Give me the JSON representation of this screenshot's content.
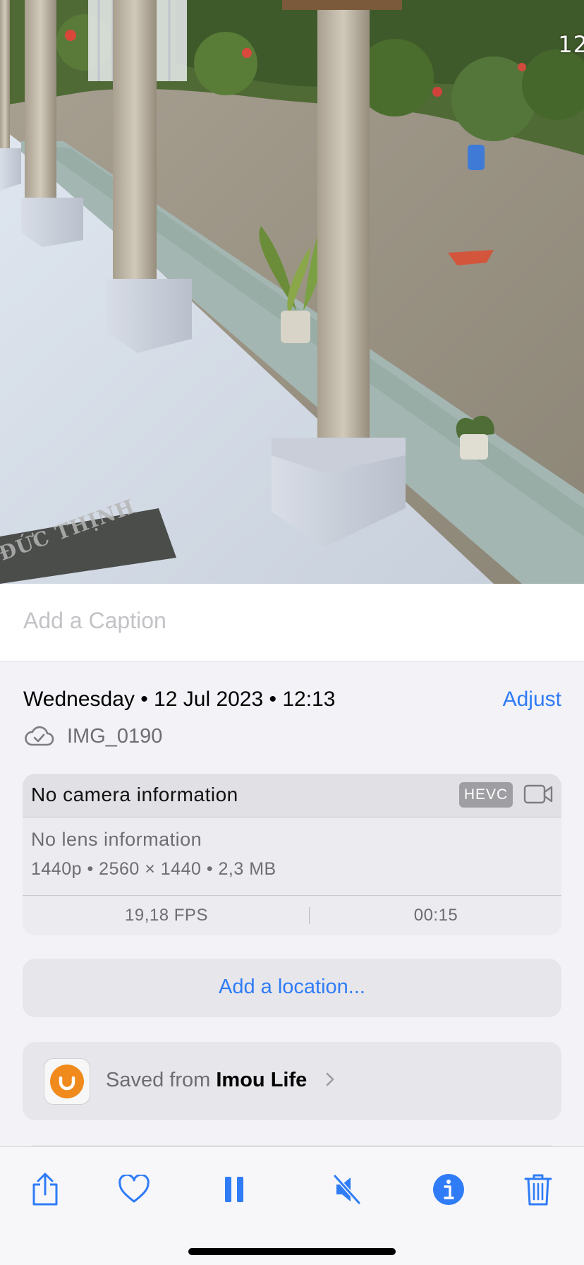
{
  "photo": {
    "timestamp_overlay": "12",
    "mat_text": "ĐỨC THỊNH"
  },
  "caption": {
    "placeholder": "Add a Caption"
  },
  "info": {
    "date": "Wednesday • 12 Jul 2023 • 12:13",
    "adjust_label": "Adjust",
    "filename": "IMG_0190",
    "cloud_icon": "icloud-checkmark-icon"
  },
  "metadata": {
    "camera": "No camera information",
    "format_badge": "HEVC",
    "media_icon": "video-camera-icon",
    "lens": "No lens information",
    "specs": "1440p  •  2560 × 1440  •  2,3 MB",
    "fps": "19,18 FPS",
    "duration": "00:15"
  },
  "location": {
    "label": "Add a location..."
  },
  "source": {
    "prefix": "Saved from",
    "app_name": "Imou Life"
  },
  "toolbar": {
    "items": [
      {
        "name": "share-icon"
      },
      {
        "name": "heart-icon"
      },
      {
        "name": "pause-icon"
      },
      {
        "name": "speaker-muted-icon"
      },
      {
        "name": "info-icon"
      },
      {
        "name": "trash-icon"
      }
    ]
  },
  "colors": {
    "accent": "#2f7cf6",
    "app_icon": "#f08a1c",
    "background": "#f2f2f7"
  }
}
